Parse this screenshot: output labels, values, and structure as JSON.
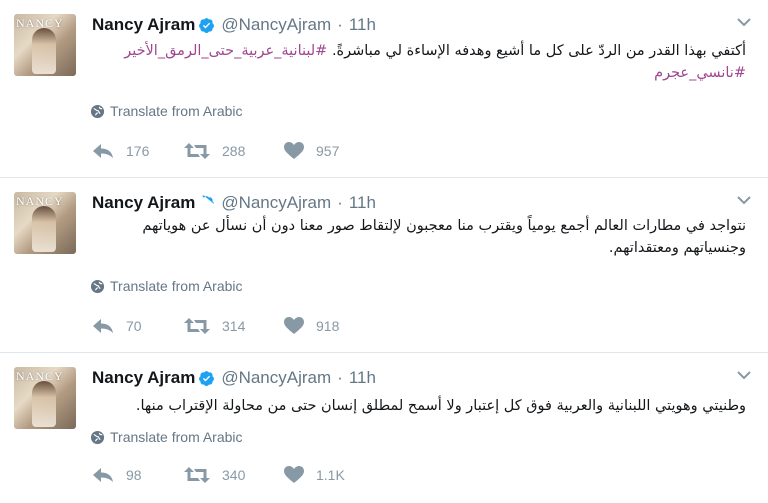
{
  "tweets": [
    {
      "name": "Nancy Ajram",
      "handle": "@NancyAjram",
      "separator": "·",
      "time": "11h",
      "avatar_text": "NANCY",
      "text": "أكتفي بهذا القدر من الردّ على كل ما أشيع وهدفه الإساءة لي مباشرةً. ",
      "hashtags": "#لبنانية_عربية_حتى_الرمق_الأخير #نانسي_عجرم",
      "translate": "Translate from Arabic",
      "replies": "176",
      "retweets": "288",
      "likes": "957"
    },
    {
      "name": "Nancy Ajram",
      "handle": "@NancyAjram",
      "separator": "·",
      "time": "11h",
      "avatar_text": "NANCY",
      "text": "نتواجد في مطارات العالم أجمع يومياً ويقترب منا معجبون لإلتقاط صور معنا دون أن نسأل عن هوياتهم وجنسياتهم ومعتقداتهم.",
      "hashtags": "",
      "translate": "Translate from Arabic",
      "replies": "70",
      "retweets": "314",
      "likes": "918"
    },
    {
      "name": "Nancy Ajram",
      "handle": "@NancyAjram",
      "separator": "·",
      "time": "11h",
      "avatar_text": "NANCY",
      "text": "وطنيتي وهويتي اللبنانية والعربية فوق كل إعتبار ولا أسمح لمطلق إنسان حتى من محاولة الإقتراب منها.",
      "hashtags": "",
      "translate": "Translate from Arabic",
      "replies": "98",
      "retweets": "340",
      "likes": "1.1K"
    }
  ],
  "colors": {
    "verified": "#1da1f2",
    "hashtag": "#a0478f",
    "muted": "#657786",
    "action": "#8899a6"
  },
  "icons": [
    "verified-badge-icon",
    "chevron-down-icon",
    "globe-icon",
    "reply-icon",
    "retweet-icon",
    "heart-icon"
  ]
}
